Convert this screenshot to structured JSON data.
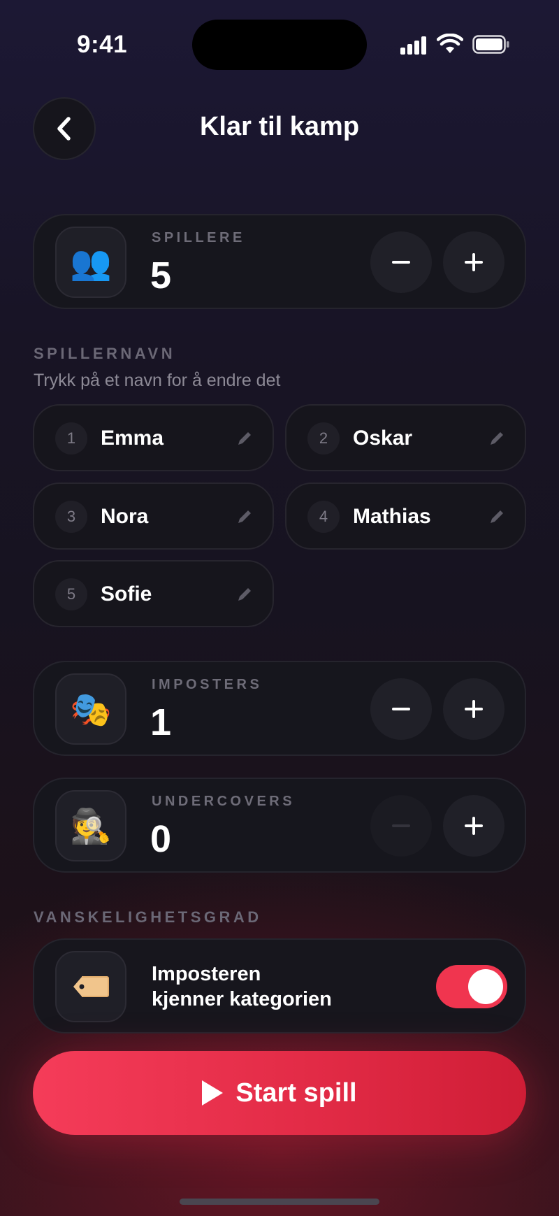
{
  "status_bar": {
    "time": "9:41"
  },
  "header": {
    "title": "Klar til kamp",
    "back_icon": "chevron-left-icon"
  },
  "players": {
    "label": "SPILLERE",
    "value": "5",
    "icon": "👥"
  },
  "player_names": {
    "heading": "SPILLERNAVN",
    "hint": "Trykk på et navn for å endre det",
    "items": [
      {
        "number": "1",
        "name": "Emma"
      },
      {
        "number": "2",
        "name": "Oskar"
      },
      {
        "number": "3",
        "name": "Nora"
      },
      {
        "number": "4",
        "name": "Mathias"
      },
      {
        "number": "5",
        "name": "Sofie"
      }
    ]
  },
  "imposters": {
    "label": "IMPOSTERS",
    "value": "1",
    "icon": "🎭"
  },
  "undercovers": {
    "label": "UNDERCOVERS",
    "value": "0",
    "icon": "🕵️",
    "minus_disabled": true
  },
  "difficulty": {
    "heading": "VANSKELIGHETSGRAD",
    "option_line1": "Imposteren",
    "option_line2": "kjenner kategorien",
    "icon": "tag-icon",
    "toggle_on": true,
    "toggle_color": "#f0354f"
  },
  "start_button": {
    "label": "Start spill",
    "color": "#f03a55"
  }
}
